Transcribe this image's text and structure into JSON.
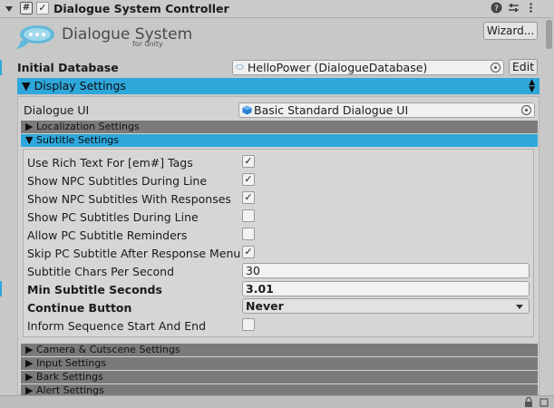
{
  "component": {
    "title": "Dialogue System Controller",
    "script_icon": "#",
    "enabled_check": "✓",
    "icons": [
      "help-icon",
      "preset-icon",
      "more-icon"
    ]
  },
  "logo": {
    "title": "Dialogue System",
    "subtitle": "for unity"
  },
  "wizard_label": "Wizard...",
  "initial_database": {
    "label": "Initial Database",
    "value": "HelloPower (DialogueDatabase)",
    "edit_label": "Edit"
  },
  "display_settings": {
    "header": "▼ Display Settings",
    "dialogue_ui_label": "Dialogue UI",
    "dialogue_ui_value": "Basic Standard Dialogue UI",
    "localization_header": "▶ Localization Settings",
    "subtitle_header": "▼ Subtitle Settings"
  },
  "subtitle_settings": [
    {
      "label": "Use Rich Text For [em#] Tags",
      "checked": "✓"
    },
    {
      "label": "Show NPC Subtitles During Line",
      "checked": "✓"
    },
    {
      "label": "Show NPC Subtitles With Responses",
      "checked": "✓"
    },
    {
      "label": "Show PC Subtitles During Line",
      "checked": ""
    },
    {
      "label": "Allow PC Subtitle Reminders",
      "checked": ""
    },
    {
      "label": "Skip PC Subtitle After Response Menu",
      "checked": "✓"
    }
  ],
  "chars_per_second": {
    "label": "Subtitle Chars Per Second",
    "value": "30"
  },
  "min_subtitle_seconds": {
    "label": "Min Subtitle Seconds",
    "value": "3.01"
  },
  "continue_button": {
    "label": "Continue Button",
    "value": "Never"
  },
  "inform_sequence": {
    "label": "Inform Sequence Start And End",
    "checked": ""
  },
  "collapsed_sections": [
    "▶ Camera & Cutscene Settings",
    "▶ Input Settings",
    "▶ Bark Settings",
    "▶ Alert Settings"
  ],
  "colors": {
    "accent": "#2ea7db",
    "section_dark": "#7a7a7a"
  }
}
